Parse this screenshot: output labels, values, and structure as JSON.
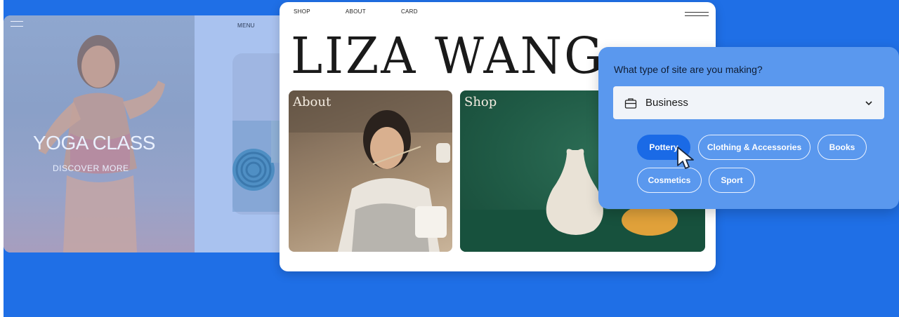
{
  "yoga": {
    "menu_label": "MENU",
    "title": "YOGA CLASS",
    "subtitle": "DISCOVER MORE",
    "menu_icon": "hamburger-icon"
  },
  "site": {
    "nav": [
      "SHOP",
      "ABOUT",
      "CARD"
    ],
    "menu_icon": "hamburger-icon",
    "title": "LIZA WANG",
    "photos": [
      {
        "label": "About"
      },
      {
        "label": "Shop"
      }
    ]
  },
  "panel": {
    "question": "What type of site are you making?",
    "select": {
      "icon": "briefcase-icon",
      "value": "Business",
      "chevron": "chevron-down-icon"
    },
    "chips": [
      {
        "label": "Pottery",
        "active": true
      },
      {
        "label": "Clothing & Accessories",
        "active": false
      },
      {
        "label": "Books",
        "active": false
      },
      {
        "label": "Cosmetics",
        "active": false
      },
      {
        "label": "Sport",
        "active": false
      }
    ]
  },
  "colors": {
    "background": "#1f6fe6",
    "panel": "#5a98ee",
    "active_chip": "#1a6ae6",
    "input_bg": "#f1f4f9"
  }
}
